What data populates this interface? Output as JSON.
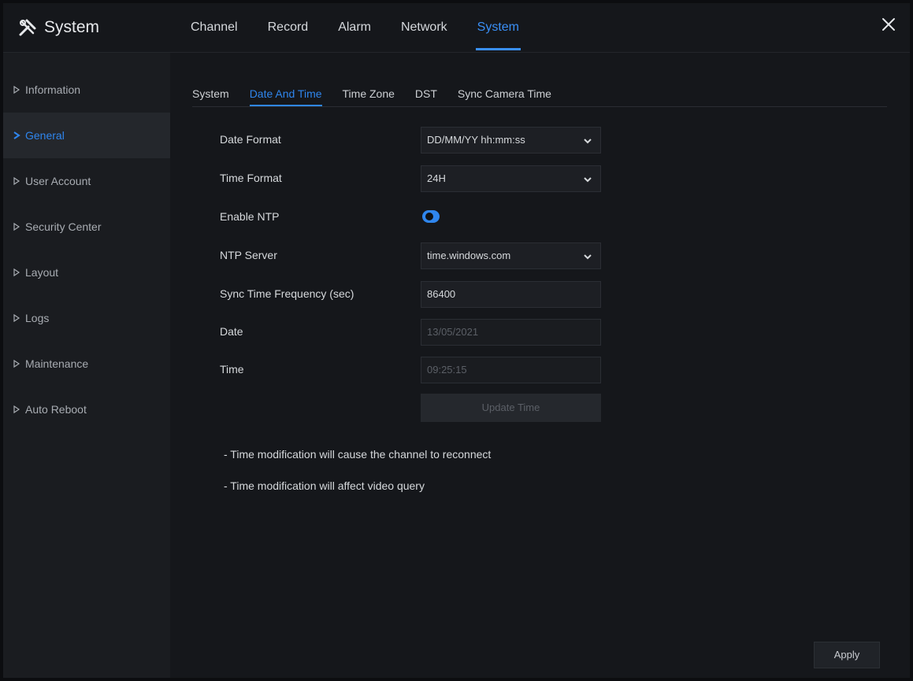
{
  "app": {
    "title": "System"
  },
  "top_tabs": [
    {
      "label": "Channel"
    },
    {
      "label": "Record"
    },
    {
      "label": "Alarm"
    },
    {
      "label": "Network"
    },
    {
      "label": "System"
    }
  ],
  "sidebar": {
    "items": [
      {
        "label": "Information"
      },
      {
        "label": "General"
      },
      {
        "label": "User Account"
      },
      {
        "label": "Security Center"
      },
      {
        "label": "Layout"
      },
      {
        "label": "Logs"
      },
      {
        "label": "Maintenance"
      },
      {
        "label": "Auto Reboot"
      }
    ]
  },
  "sub_tabs": [
    {
      "label": "System"
    },
    {
      "label": "Date And Time"
    },
    {
      "label": "Time Zone"
    },
    {
      "label": "DST"
    },
    {
      "label": "Sync Camera Time"
    }
  ],
  "form": {
    "date_format": {
      "label": "Date Format",
      "value": "DD/MM/YY hh:mm:ss"
    },
    "time_format": {
      "label": "Time Format",
      "value": "24H"
    },
    "enable_ntp": {
      "label": "Enable NTP",
      "value": true
    },
    "ntp_server": {
      "label": "NTP Server",
      "value": "time.windows.com"
    },
    "sync_freq": {
      "label": "Sync Time Frequency (sec)",
      "value": "86400"
    },
    "date": {
      "label": "Date",
      "value": "13/05/2021"
    },
    "time": {
      "label": "Time",
      "value": "09:25:15"
    },
    "update_button": "Update Time"
  },
  "notes": [
    "- Time modification will cause the channel to reconnect",
    "- Time modification will affect video query"
  ],
  "apply_button": "Apply",
  "colors": {
    "accent": "#2f86ee",
    "background": "#15171b",
    "sidebar": "#1a1c20"
  }
}
